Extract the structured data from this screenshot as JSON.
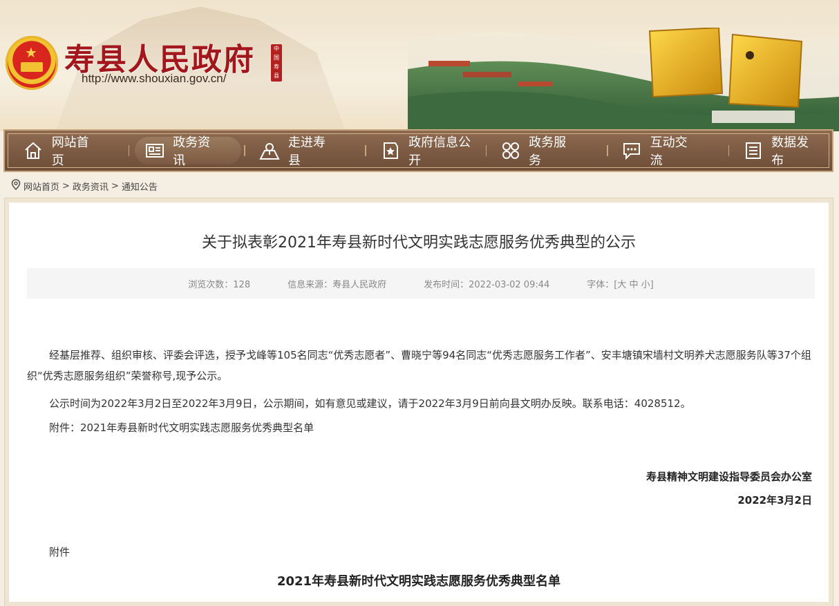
{
  "header": {
    "title": "寿县人民政府",
    "url": "http://www.shouxian.gov.cn/",
    "seal_text": "中国寿县"
  },
  "nav": {
    "items": [
      {
        "label": "网站首页",
        "icon": "home-icon"
      },
      {
        "label": "政务资讯",
        "icon": "news-icon",
        "active": true
      },
      {
        "label": "走进寿县",
        "icon": "map-pin-icon"
      },
      {
        "label": "政府信息公开",
        "icon": "document-star-icon"
      },
      {
        "label": "政务服务",
        "icon": "grid-service-icon"
      },
      {
        "label": "互动交流",
        "icon": "chat-icon"
      },
      {
        "label": "数据发布",
        "icon": "list-data-icon"
      }
    ]
  },
  "breadcrumb": {
    "home": "网站首页",
    "section": "政务资讯",
    "page": "通知公告",
    "separator": ">"
  },
  "article": {
    "title": "关于拟表彰2021年寿县新时代文明实践志愿服务优秀典型的公示",
    "meta": {
      "views": "浏览次数：128",
      "source": "信息来源：寿县人民政府",
      "date": "发布时间：2022-03-02 09:44",
      "font": "字体：[大 中 小]"
    },
    "paragraphs": [
      "经基层推荐、组织审核、评委会评选，授予戈峰等105名同志“优秀志愿者”、曹晓宁等94名同志“优秀志愿服务工作者”、安丰塘镇宋墙村文明养犬志愿服务队等37个组织“优秀志愿服务组织”荣誉称号,现予公示。",
      "公示时间为2022年3月2日至2022年3月9日，公示期间，如有意见或建议，请于2022年3月9日前向县文明办反映。联系电话：4028512。",
      "附件：2021年寿县新时代文明实践志愿服务优秀典型名单"
    ],
    "signature": "寿县精神文明建设指导委员会办公室",
    "sign_date": "2022年3月2日",
    "attachment_label": "附件",
    "list_title": "2021年寿县新时代文明实践志愿服务优秀典型名单"
  },
  "colors": {
    "brand_red": "#a3161b",
    "nav_brown": "#7c5a42",
    "page_bg": "#f5efe3"
  }
}
